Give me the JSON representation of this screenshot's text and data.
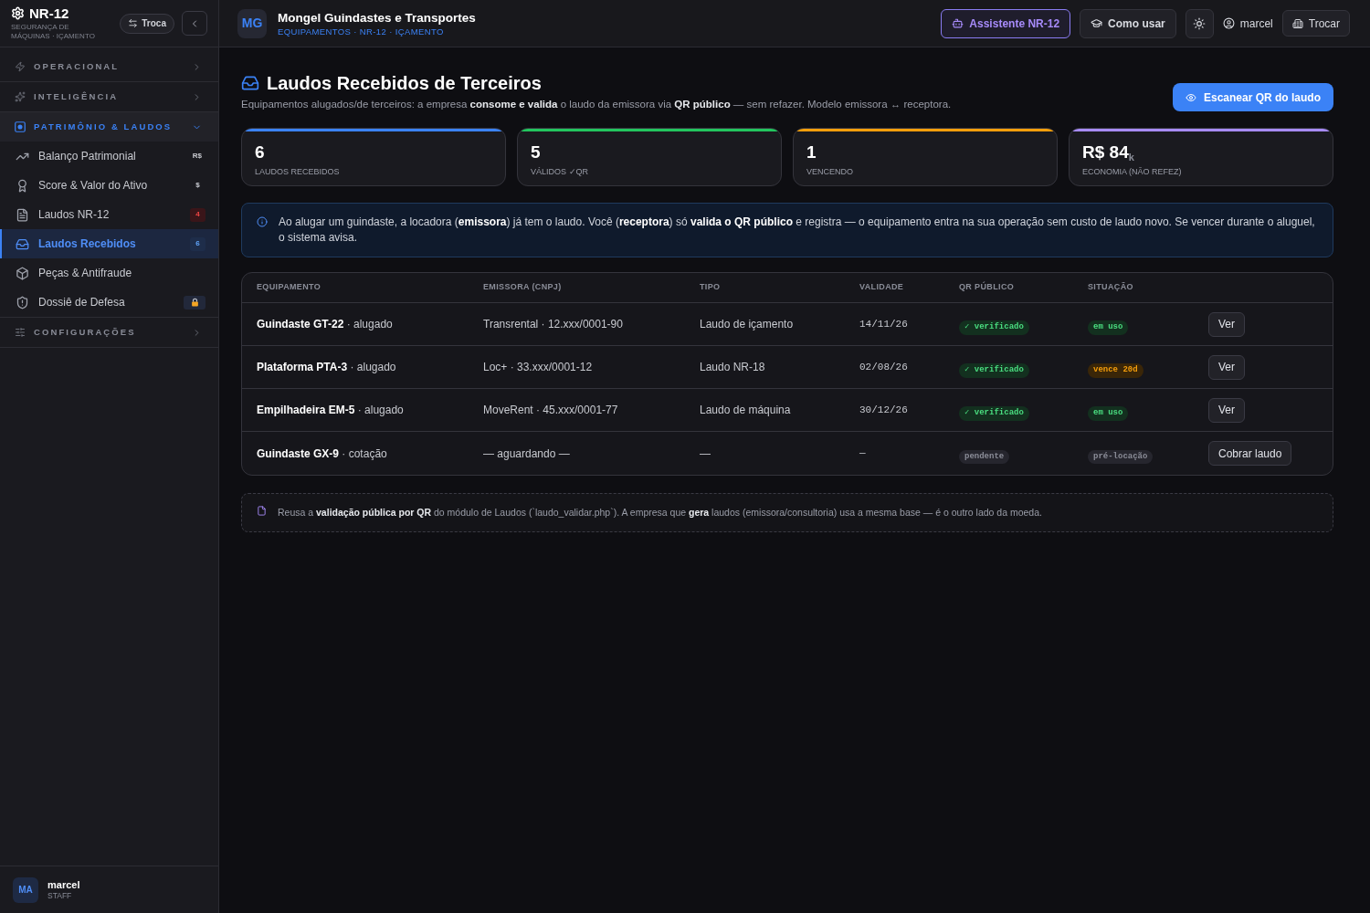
{
  "sidebar": {
    "brand": {
      "title": "NR-12",
      "subtitle": "SEGURANÇA DE MÁQUINAS · IÇAMENTO"
    },
    "switch_button": "Troca",
    "sections": [
      {
        "label": "OPERACIONAL",
        "expanded": false
      },
      {
        "label": "INTELIGÊNCIA",
        "expanded": false
      },
      {
        "label": "PATRIMÔNIO & LAUDOS",
        "expanded": true,
        "items": [
          {
            "label": "Balanço Patrimonial",
            "badge": "R$",
            "kind": "plain",
            "locked": false,
            "selected": false
          },
          {
            "label": "Score & Valor do Ativo",
            "badge": "$",
            "kind": "plain",
            "locked": false,
            "selected": false
          },
          {
            "label": "Laudos NR-12",
            "badge": "4",
            "kind": "alert",
            "locked": false,
            "selected": false
          },
          {
            "label": "Laudos Recebidos",
            "badge": "6",
            "kind": "info",
            "locked": false,
            "selected": true
          },
          {
            "label": "Peças & Antifraude",
            "locked": false,
            "selected": false
          },
          {
            "label": "Dossiê de Defesa",
            "locked": true,
            "selected": false
          }
        ]
      },
      {
        "label": "CONFIGURAÇÕES",
        "expanded": false
      }
    ],
    "user": {
      "initials": "MA",
      "name": "marcel",
      "role": "STAFF"
    }
  },
  "header": {
    "avatar": "MG",
    "company": "Mongel Guindastes e Transportes",
    "breadcrumb": "EQUIPAMENTOS · NR-12 · IÇAMENTO",
    "assistant_button": "Assistente NR-12",
    "help_button": "Como usar",
    "user": "marcel",
    "switch_button": "Trocar"
  },
  "page": {
    "title": "Laudos Recebidos de Terceiros",
    "subtitle": "Equipamentos alugados/de terceiros: a empresa **consome e valida** o laudo da emissora via **QR público** — sem refazer. Modelo emissora ↔ receptora.",
    "scan_button": "Escanear QR do laudo"
  },
  "stats": [
    {
      "value": "6",
      "label": "LAUDOS RECEBIDOS",
      "color": "#3b82f6"
    },
    {
      "value": "5",
      "label": "VÁLIDOS ✓QR",
      "color": "#22c55e"
    },
    {
      "value": "1",
      "label": "VENCENDO",
      "color": "#f59e0b"
    },
    {
      "value": "R$ 84$_{k}$",
      "label": "ECONOMIA (NÃO REFEZ)",
      "color": "#a78bfa"
    }
  ],
  "info_box": {
    "text": "Ao alugar um guindaste, a locadora (**emissora**) já tem o laudo. Você (**receptora**) só **valida o QR público** e registra — o equipamento entra na sua operação sem custo de laudo novo. Se vencer durante o aluguel, o sistema avisa."
  },
  "table": {
    "columns": [
      "EQUIPAMENTO",
      "EMISSORA (CNPJ)",
      "TIPO",
      "VALIDADE",
      "QR PÚBLICO",
      "SITUAÇÃO"
    ],
    "rows": [
      {
        "equipment": "**Guindaste GT-22** · alugado",
        "issuer": "Transrental · 12.xxx/0001-90",
        "type": "Laudo de içamento",
        "validity": "14/11/26",
        "qr": {
          "text": "✓ verificado",
          "kind": "ok"
        },
        "status": {
          "text": "em uso",
          "kind": "ok"
        },
        "action": "Ver"
      },
      {
        "equipment": "**Plataforma PTA-3** · alugado",
        "issuer": "Loc+ · 33.xxx/0001-12",
        "type": "Laudo NR-18",
        "validity": "02/08/26",
        "qr": {
          "text": "✓ verificado",
          "kind": "ok"
        },
        "status": {
          "text": "vence 20d",
          "kind": "warning"
        },
        "action": "Ver"
      },
      {
        "equipment": "**Empilhadeira EM-5** · alugado",
        "issuer": "MoveRent · 45.xxx/0001-77",
        "type": "Laudo de máquina",
        "validity": "30/12/26",
        "qr": {
          "text": "✓ verificado",
          "kind": "ok"
        },
        "status": {
          "text": "em uso",
          "kind": "ok"
        },
        "action": "Ver"
      },
      {
        "equipment": "**Guindaste GX-9** · cotação",
        "issuer": "— aguardando —",
        "type": "—",
        "validity": "—",
        "qr": {
          "text": "pendente",
          "kind": "muted"
        },
        "status": {
          "text": "pré-locação",
          "kind": "muted"
        },
        "action": "Cobrar laudo"
      }
    ]
  },
  "note": {
    "text": "Reusa a **validação pública por QR** do módulo de Laudos (`laudo_validar.php`). A empresa que **gera** laudos (emissora/consultoria) usa a mesma base — é o outro lado da moeda."
  }
}
